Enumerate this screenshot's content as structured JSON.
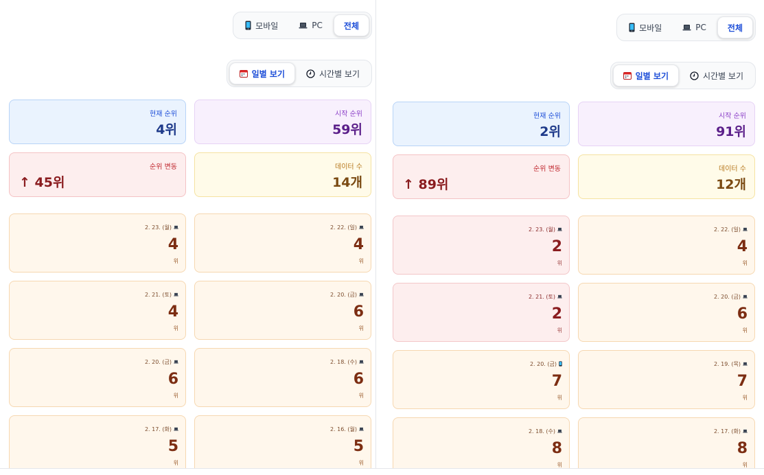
{
  "panels": [
    {
      "device_tabs": [
        {
          "label": "모바일",
          "icon": "mobile-icon",
          "active": false
        },
        {
          "label": "PC",
          "icon": "laptop-icon",
          "active": false
        },
        {
          "label": "전체",
          "icon": "",
          "active": true
        }
      ],
      "view_tabs": [
        {
          "label": "일별 보기",
          "icon": "calendar-icon",
          "active": true
        },
        {
          "label": "시간별 보기",
          "icon": "clock-icon",
          "active": false
        }
      ],
      "stats": {
        "current": {
          "label": "현재 순위",
          "value": "4위"
        },
        "start": {
          "label": "시작 순위",
          "value": "59위"
        },
        "change": {
          "label": "순위 변동",
          "value": "↑ 45위"
        },
        "count": {
          "label": "데이터 수",
          "value": "14개"
        }
      },
      "days": [
        {
          "date": "2. 23. (월)",
          "device": "laptop-icon",
          "rank": "4",
          "unit": "위",
          "tone": "orange"
        },
        {
          "date": "2. 22. (일)",
          "device": "laptop-icon",
          "rank": "4",
          "unit": "위",
          "tone": "orange"
        },
        {
          "date": "2. 21. (토)",
          "device": "laptop-icon",
          "rank": "4",
          "unit": "위",
          "tone": "orange"
        },
        {
          "date": "2. 20. (금)",
          "device": "laptop-icon",
          "rank": "6",
          "unit": "위",
          "tone": "orange"
        },
        {
          "date": "2. 20. (금)",
          "device": "laptop-icon",
          "rank": "6",
          "unit": "위",
          "tone": "orange"
        },
        {
          "date": "2. 18. (수)",
          "device": "laptop-icon",
          "rank": "6",
          "unit": "위",
          "tone": "orange"
        },
        {
          "date": "2. 17. (화)",
          "device": "laptop-icon",
          "rank": "5",
          "unit": "위",
          "tone": "orange"
        },
        {
          "date": "2. 16. (월)",
          "device": "laptop-icon",
          "rank": "5",
          "unit": "위",
          "tone": "orange"
        }
      ]
    },
    {
      "device_tabs": [
        {
          "label": "모바일",
          "icon": "mobile-icon",
          "active": false
        },
        {
          "label": "PC",
          "icon": "laptop-icon",
          "active": false
        },
        {
          "label": "전체",
          "icon": "",
          "active": true
        }
      ],
      "view_tabs": [
        {
          "label": "일별 보기",
          "icon": "calendar-icon",
          "active": true
        },
        {
          "label": "시간별 보기",
          "icon": "clock-icon",
          "active": false
        }
      ],
      "stats": {
        "current": {
          "label": "현재 순위",
          "value": "2위"
        },
        "start": {
          "label": "시작 순위",
          "value": "91위"
        },
        "change": {
          "label": "순위 변동",
          "value": "↑ 89위"
        },
        "count": {
          "label": "데이터 수",
          "value": "12개"
        }
      },
      "days": [
        {
          "date": "2. 23. (월)",
          "device": "laptop-icon",
          "rank": "2",
          "unit": "위",
          "tone": "red"
        },
        {
          "date": "2. 22. (일)",
          "device": "laptop-icon",
          "rank": "4",
          "unit": "위",
          "tone": "orange"
        },
        {
          "date": "2. 21. (토)",
          "device": "laptop-icon",
          "rank": "2",
          "unit": "위",
          "tone": "red"
        },
        {
          "date": "2. 20. (금)",
          "device": "laptop-icon",
          "rank": "6",
          "unit": "위",
          "tone": "orange"
        },
        {
          "date": "2. 20. (금)",
          "device": "mobile-icon",
          "rank": "7",
          "unit": "위",
          "tone": "orange"
        },
        {
          "date": "2. 19. (목)",
          "device": "laptop-icon",
          "rank": "7",
          "unit": "위",
          "tone": "orange"
        },
        {
          "date": "2. 18. (수)",
          "device": "laptop-icon",
          "rank": "8",
          "unit": "위",
          "tone": "orange"
        },
        {
          "date": "2. 17. (화)",
          "device": "laptop-icon",
          "rank": "8",
          "unit": "위",
          "tone": "orange"
        }
      ]
    }
  ]
}
